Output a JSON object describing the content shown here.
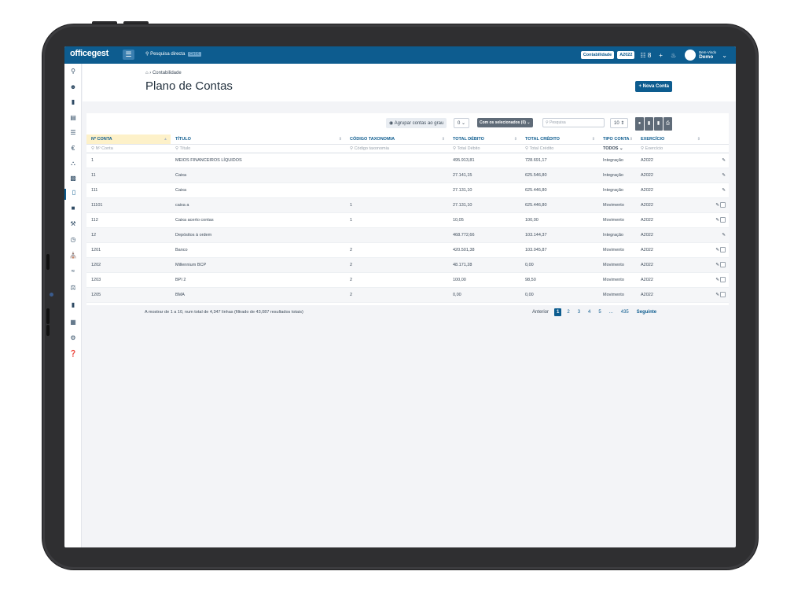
{
  "topbar": {
    "logo": "officegest",
    "search_label": "Pesquisa directa",
    "shortcut": "Ctrl K",
    "module_chip": "Contabilidade",
    "year_chip": "A2022",
    "grid_indicator": "8",
    "welcome": "Bem-Vindo",
    "user": "Demo"
  },
  "sidebar": {
    "icons": [
      "search-icon",
      "users-icon",
      "book-icon",
      "chart-icon",
      "list-icon",
      "euro-icon",
      "cart-icon",
      "money-icon",
      "document-icon",
      "truck-icon",
      "org-chart-icon",
      "clock-icon",
      "bank-icon",
      "analysis-icon",
      "tax-icon",
      "file-icon",
      "table-icon",
      "settings-icon",
      "help-icon"
    ]
  },
  "header": {
    "breadcrumb": "Contabilidade",
    "title": "Plano de Contas",
    "new_button": "+ Nova Conta"
  },
  "toolbar": {
    "group_label": "Agrupar contas ao grau",
    "group_value": "0",
    "selected_button": "Com os selecionados (0)",
    "search_placeholder": "Pesquisa",
    "page_size": "10"
  },
  "table": {
    "headers": [
      "Nº CONTA",
      "TÍTULO",
      "CÓDIGO TAXONOMIA",
      "TOTAL DÉBITO",
      "TOTAL CRÉDITO",
      "TIPO CONTA",
      "EXERCÍCIO"
    ],
    "filters": [
      "Nº Conta",
      "Título",
      "Código taxonomia",
      "Total Débito",
      "Total Crédito",
      "TODOS",
      "Exercício"
    ],
    "rows": [
      {
        "conta": "1",
        "titulo": "MEIOS FINANCEIROS LÍQUIDOS",
        "taxonomia": "",
        "debito": "495.913,81",
        "credito": "728.691,17",
        "tipo": "Integração",
        "exercicio": "A2022"
      },
      {
        "conta": "11",
        "titulo": "Caixa",
        "taxonomia": "",
        "debito": "27.141,15",
        "credito": "625.546,80",
        "tipo": "Integração",
        "exercicio": "A2022"
      },
      {
        "conta": "111",
        "titulo": "Caixa",
        "taxonomia": "",
        "debito": "27.131,10",
        "credito": "625.446,80",
        "tipo": "Integração",
        "exercicio": "A2022"
      },
      {
        "conta": "11101",
        "titulo": "caixa a",
        "taxonomia": "1",
        "debito": "27.131,10",
        "credito": "625.446,80",
        "tipo": "Movimento",
        "exercicio": "A2022"
      },
      {
        "conta": "112",
        "titulo": "Caixa acerto contas",
        "taxonomia": "1",
        "debito": "10,05",
        "credito": "100,00",
        "tipo": "Movimento",
        "exercicio": "A2022"
      },
      {
        "conta": "12",
        "titulo": "Depósitos à ordem",
        "taxonomia": "",
        "debito": "468.772,66",
        "credito": "103.144,37",
        "tipo": "Integração",
        "exercicio": "A2022"
      },
      {
        "conta": "1201",
        "titulo": "Banco",
        "taxonomia": "2",
        "debito": "420.501,38",
        "credito": "103.045,87",
        "tipo": "Movimento",
        "exercicio": "A2022"
      },
      {
        "conta": "1202",
        "titulo": "Millennium BCP",
        "taxonomia": "2",
        "debito": "48.171,28",
        "credito": "0,00",
        "tipo": "Movimento",
        "exercicio": "A2022"
      },
      {
        "conta": "1203",
        "titulo": "BPI 2",
        "taxonomia": "2",
        "debito": "100,00",
        "credito": "98,50",
        "tipo": "Movimento",
        "exercicio": "A2022"
      },
      {
        "conta": "1205",
        "titulo": "BMA",
        "taxonomia": "2",
        "debito": "0,00",
        "credito": "0,00",
        "tipo": "Movimento",
        "exercicio": "A2022"
      }
    ]
  },
  "footer": {
    "info": "A mostrar de 1 a 10, num total de 4,347 linhas (filtrado de 43,087 resultados totais)",
    "prev": "Anterior",
    "pages": [
      "1",
      "2",
      "3",
      "4",
      "5",
      "...",
      "435"
    ],
    "next": "Seguinte"
  }
}
